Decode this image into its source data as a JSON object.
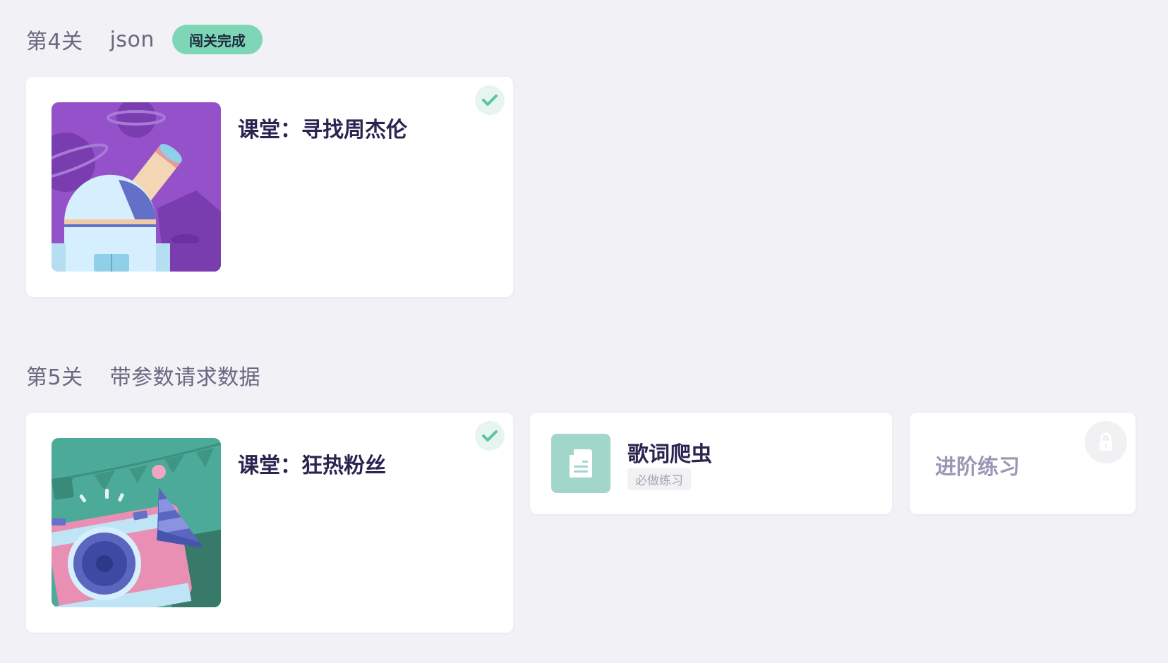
{
  "levels": [
    {
      "number_label": "第4关",
      "name": "json",
      "badge": "闯关完成",
      "cards": [
        {
          "title": "课堂：寻找周杰伦",
          "completed": true,
          "thumbnail": "telescope-observatory-illustration"
        }
      ]
    },
    {
      "number_label": "第5关",
      "name": "带参数请求数据",
      "cards": [
        {
          "title": "课堂：狂热粉丝",
          "completed": true,
          "thumbnail": "camera-party-hat-illustration"
        },
        {
          "title": "歌词爬虫",
          "tag": "必做练习",
          "icon": "document-icon"
        },
        {
          "title": "进阶练习",
          "locked": true,
          "icon": "lock-icon"
        }
      ]
    }
  ],
  "colors": {
    "page_background": "#f1f1f6",
    "badge_green": "#7dd6b6",
    "check_green": "#5cc79f",
    "exercise_icon_bg": "#a3d6ca",
    "title_dark": "#2a2450",
    "locked_text": "#9b96b3"
  }
}
